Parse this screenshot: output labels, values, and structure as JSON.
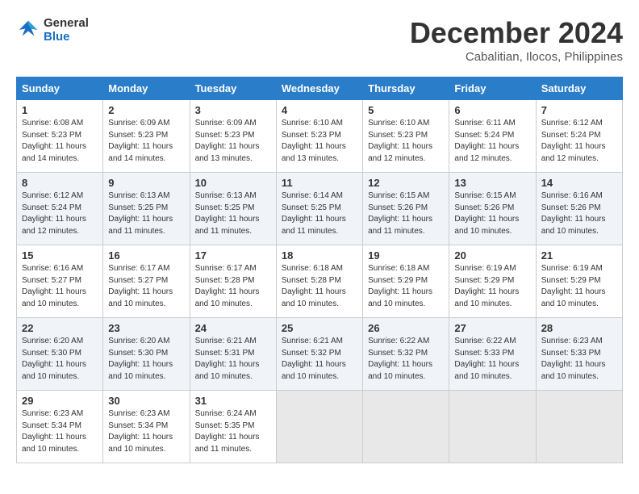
{
  "logo": {
    "line1": "General",
    "line2": "Blue"
  },
  "title": "December 2024",
  "subtitle": "Cabalitian, Ilocos, Philippines",
  "weekdays": [
    "Sunday",
    "Monday",
    "Tuesday",
    "Wednesday",
    "Thursday",
    "Friday",
    "Saturday"
  ],
  "weeks": [
    [
      {
        "day": "1",
        "sunrise": "6:08 AM",
        "sunset": "5:23 PM",
        "daylight": "11 hours and 14 minutes."
      },
      {
        "day": "2",
        "sunrise": "6:09 AM",
        "sunset": "5:23 PM",
        "daylight": "11 hours and 14 minutes."
      },
      {
        "day": "3",
        "sunrise": "6:09 AM",
        "sunset": "5:23 PM",
        "daylight": "11 hours and 13 minutes."
      },
      {
        "day": "4",
        "sunrise": "6:10 AM",
        "sunset": "5:23 PM",
        "daylight": "11 hours and 13 minutes."
      },
      {
        "day": "5",
        "sunrise": "6:10 AM",
        "sunset": "5:23 PM",
        "daylight": "11 hours and 12 minutes."
      },
      {
        "day": "6",
        "sunrise": "6:11 AM",
        "sunset": "5:24 PM",
        "daylight": "11 hours and 12 minutes."
      },
      {
        "day": "7",
        "sunrise": "6:12 AM",
        "sunset": "5:24 PM",
        "daylight": "11 hours and 12 minutes."
      }
    ],
    [
      {
        "day": "8",
        "sunrise": "6:12 AM",
        "sunset": "5:24 PM",
        "daylight": "11 hours and 12 minutes."
      },
      {
        "day": "9",
        "sunrise": "6:13 AM",
        "sunset": "5:25 PM",
        "daylight": "11 hours and 11 minutes."
      },
      {
        "day": "10",
        "sunrise": "6:13 AM",
        "sunset": "5:25 PM",
        "daylight": "11 hours and 11 minutes."
      },
      {
        "day": "11",
        "sunrise": "6:14 AM",
        "sunset": "5:25 PM",
        "daylight": "11 hours and 11 minutes."
      },
      {
        "day": "12",
        "sunrise": "6:15 AM",
        "sunset": "5:26 PM",
        "daylight": "11 hours and 11 minutes."
      },
      {
        "day": "13",
        "sunrise": "6:15 AM",
        "sunset": "5:26 PM",
        "daylight": "11 hours and 10 minutes."
      },
      {
        "day": "14",
        "sunrise": "6:16 AM",
        "sunset": "5:26 PM",
        "daylight": "11 hours and 10 minutes."
      }
    ],
    [
      {
        "day": "15",
        "sunrise": "6:16 AM",
        "sunset": "5:27 PM",
        "daylight": "11 hours and 10 minutes."
      },
      {
        "day": "16",
        "sunrise": "6:17 AM",
        "sunset": "5:27 PM",
        "daylight": "11 hours and 10 minutes."
      },
      {
        "day": "17",
        "sunrise": "6:17 AM",
        "sunset": "5:28 PM",
        "daylight": "11 hours and 10 minutes."
      },
      {
        "day": "18",
        "sunrise": "6:18 AM",
        "sunset": "5:28 PM",
        "daylight": "11 hours and 10 minutes."
      },
      {
        "day": "19",
        "sunrise": "6:18 AM",
        "sunset": "5:29 PM",
        "daylight": "11 hours and 10 minutes."
      },
      {
        "day": "20",
        "sunrise": "6:19 AM",
        "sunset": "5:29 PM",
        "daylight": "11 hours and 10 minutes."
      },
      {
        "day": "21",
        "sunrise": "6:19 AM",
        "sunset": "5:29 PM",
        "daylight": "11 hours and 10 minutes."
      }
    ],
    [
      {
        "day": "22",
        "sunrise": "6:20 AM",
        "sunset": "5:30 PM",
        "daylight": "11 hours and 10 minutes."
      },
      {
        "day": "23",
        "sunrise": "6:20 AM",
        "sunset": "5:30 PM",
        "daylight": "11 hours and 10 minutes."
      },
      {
        "day": "24",
        "sunrise": "6:21 AM",
        "sunset": "5:31 PM",
        "daylight": "11 hours and 10 minutes."
      },
      {
        "day": "25",
        "sunrise": "6:21 AM",
        "sunset": "5:32 PM",
        "daylight": "11 hours and 10 minutes."
      },
      {
        "day": "26",
        "sunrise": "6:22 AM",
        "sunset": "5:32 PM",
        "daylight": "11 hours and 10 minutes."
      },
      {
        "day": "27",
        "sunrise": "6:22 AM",
        "sunset": "5:33 PM",
        "daylight": "11 hours and 10 minutes."
      },
      {
        "day": "28",
        "sunrise": "6:23 AM",
        "sunset": "5:33 PM",
        "daylight": "11 hours and 10 minutes."
      }
    ],
    [
      {
        "day": "29",
        "sunrise": "6:23 AM",
        "sunset": "5:34 PM",
        "daylight": "11 hours and 10 minutes."
      },
      {
        "day": "30",
        "sunrise": "6:23 AM",
        "sunset": "5:34 PM",
        "daylight": "11 hours and 10 minutes."
      },
      {
        "day": "31",
        "sunrise": "6:24 AM",
        "sunset": "5:35 PM",
        "daylight": "11 hours and 11 minutes."
      },
      null,
      null,
      null,
      null
    ]
  ]
}
